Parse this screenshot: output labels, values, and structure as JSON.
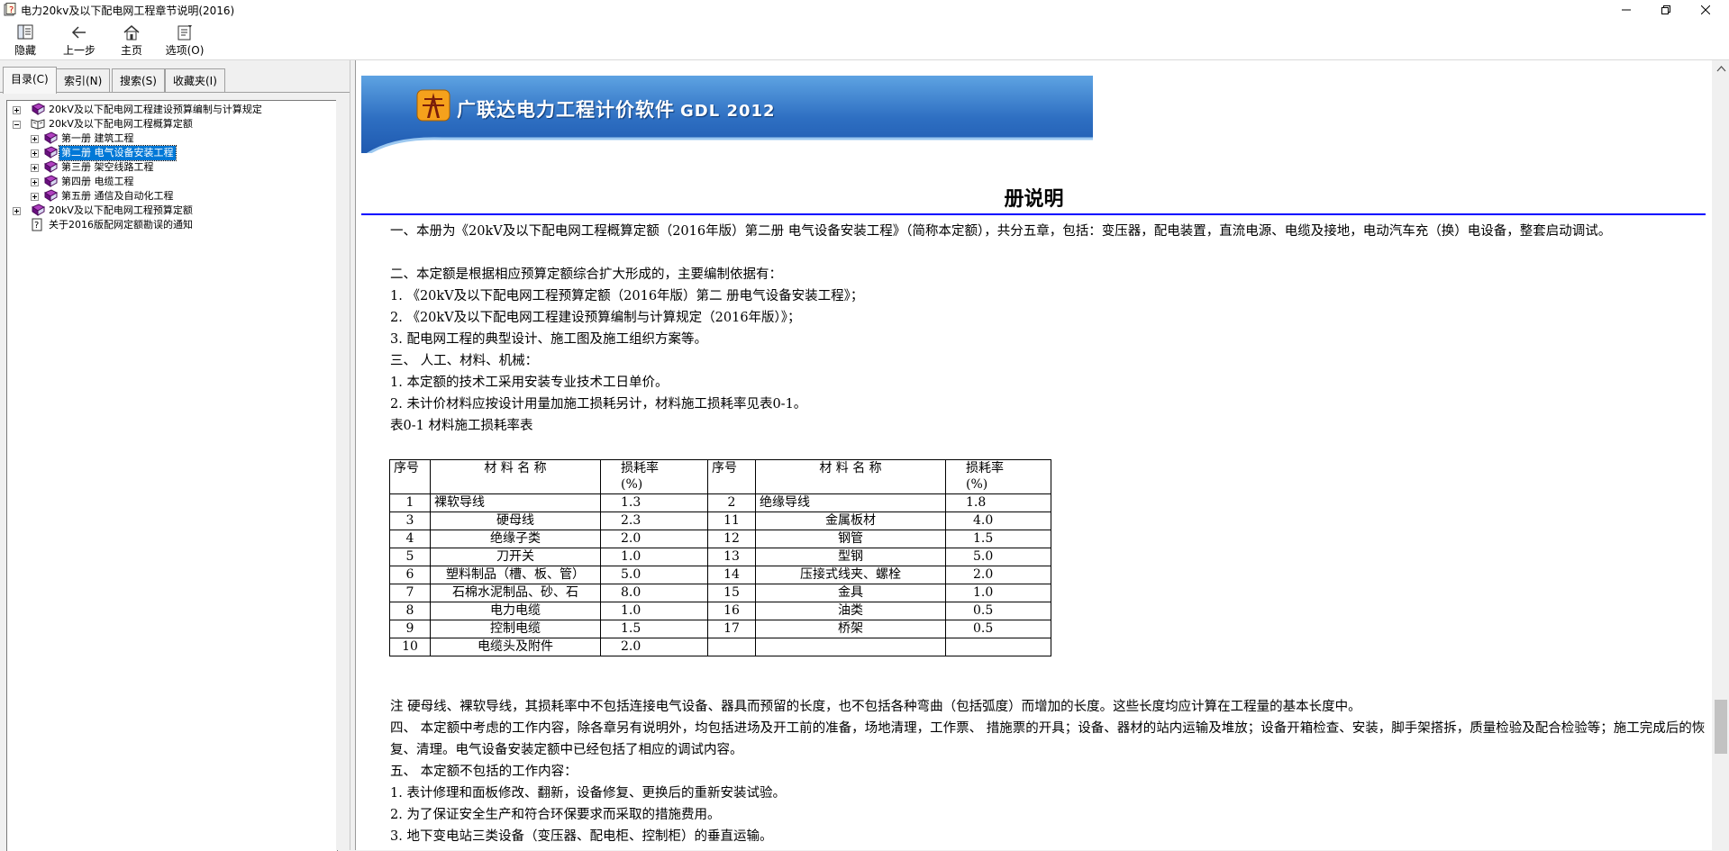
{
  "window": {
    "title": "电力20kv及以下配电网工程章节说明(2016)"
  },
  "toolbar": [
    {
      "label": "隐藏",
      "icon": "hide-icon"
    },
    {
      "label": "上一步",
      "icon": "back-arrow-icon"
    },
    {
      "label": "主页",
      "icon": "home-icon"
    },
    {
      "label": "选项(O)",
      "icon": "options-icon"
    }
  ],
  "tabs": [
    "目录(C)",
    "索引(N)",
    "搜索(S)",
    "收藏夹(I)"
  ],
  "tree": [
    {
      "label": "20kV及以下配电网工程建设预算编制与计算规定",
      "icon": "book-icon"
    },
    {
      "label": "20kV及以下配电网工程概算定额",
      "icon": "open-book-icon"
    },
    {
      "label": "第一册  建筑工程",
      "icon": "book-icon"
    },
    {
      "label": "第二册  电气设备安装工程",
      "icon": "book-icon"
    },
    {
      "label": "第三册  架空线路工程",
      "icon": "book-icon"
    },
    {
      "label": "第四册  电缆工程",
      "icon": "book-icon"
    },
    {
      "label": "第五册  通信及自动化工程",
      "icon": "book-icon"
    },
    {
      "label": "20kV及以下配电网工程预算定额",
      "icon": "book-icon"
    },
    {
      "label": "关于2016版配网定额勘误的通知",
      "icon": "help-page-icon"
    }
  ],
  "banner": {
    "title": "广联达电力工程计价软件",
    "product": "GDL 2012"
  },
  "document": {
    "title": "册说明",
    "paragraphs": [
      "一、本册为《20kV及以下配电网工程概算定额（2016年版）第二册  电气设备安装工程》（简称本定额），共分五章，包括：变压器，配电装置，直流电源、电缆及接地，电动汽车充（换）电设备，整套启动调试。",
      "二、本定额是根据相应预算定额综合扩大形成的，主要编制依据有：",
      "1. 《20kV及以下配电网工程预算定额（2016年版）第二 册电气设备安装工程》；",
      "2. 《20kV及以下配电网工程建设预算编制与计算规定（2016年版）》；",
      "3. 配电网工程的典型设计、施工图及施工组织方案等。",
      "三、  人工、材料、机械：",
      "1. 本定额的技术工采用安装专业技术工日单价。",
      "2. 未计价材料应按设计用量加施工损耗另计，材料施工损耗率见表0-1。",
      "表0-1 材料施工损耗率表"
    ],
    "table": {
      "headers": [
        "序号",
        "材 料 名 称",
        "损耗率",
        "(%)",
        "序号",
        "材 料 名 称",
        "损耗率",
        "(%)"
      ],
      "rows": [
        [
          "1",
          "裸软导线",
          "1.3",
          "2",
          "绝缘导线",
          "1.8"
        ],
        [
          "3",
          "硬母线",
          "2.3",
          "11",
          "金属板材",
          "4.0"
        ],
        [
          "4",
          "绝缘子类",
          "2.0",
          "12",
          "钢管",
          "1.5"
        ],
        [
          "5",
          "刀开关",
          "1.0",
          "13",
          "型钢",
          "5.0"
        ],
        [
          "6",
          "塑料制品（槽、板、管）",
          "5.0",
          "14",
          "压接式线夹、螺栓",
          "2.0"
        ],
        [
          "7",
          "石棉水泥制品、砂、石",
          "8.0",
          "15",
          "金具",
          "1.0"
        ],
        [
          "8",
          "电力电缆",
          "1.0",
          "16",
          "油类",
          "0.5"
        ],
        [
          "9",
          "控制电缆",
          "1.5",
          "17",
          "桥架",
          "0.5"
        ],
        [
          "10",
          "电缆头及附件",
          "2.0",
          "",
          "",
          ""
        ]
      ]
    },
    "paragraphs_after": [
      "注  硬母线、裸软导线，其损耗率中不包括连接电气设备、器具而预留的长度，也不包括各种弯曲（包括弧度）而增加的长度。这些长度均应计算在工程量的基本长度中。",
      "四、  本定额中考虑的工作内容，除各章另有说明外，均包括进场及开工前的准备，场地清理，工作票、 措施票的开具；设备、器材的站内运输及堆放；设备开箱检查、安装，脚手架搭拆，质量检验及配合检验等；施工完成后的恢复、清理。电气设备安装定额中已经包括了相应的调试内容。",
      "五、  本定额不包括的工作内容：",
      "1. 表计修理和面板修改、翻新，设备修复、更换后的重新安装试验。",
      "2. 为了保证安全生产和符合环保要求而采取的措施费用。",
      "3. 地下变电站三类设备（变压器、配电柜、控制柜）的垂直运输。"
    ]
  }
}
